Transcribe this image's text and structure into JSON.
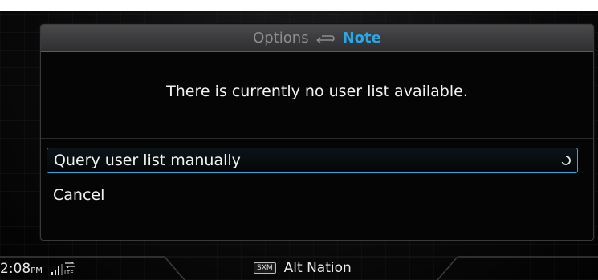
{
  "header": {
    "parent_label": "Options",
    "current_label": "Note"
  },
  "message": "There is currently no user list available.",
  "options": [
    {
      "label": "Query user list manually",
      "selected": true
    },
    {
      "label": "Cancel",
      "selected": false
    }
  ],
  "status": {
    "time": "2:08",
    "ampm": "PM",
    "network_label": "LTE",
    "source_badge": "SXM",
    "station": "Alt Nation"
  },
  "colors": {
    "accent": "#2aa7e6",
    "header_gray": "#8e8e92"
  }
}
